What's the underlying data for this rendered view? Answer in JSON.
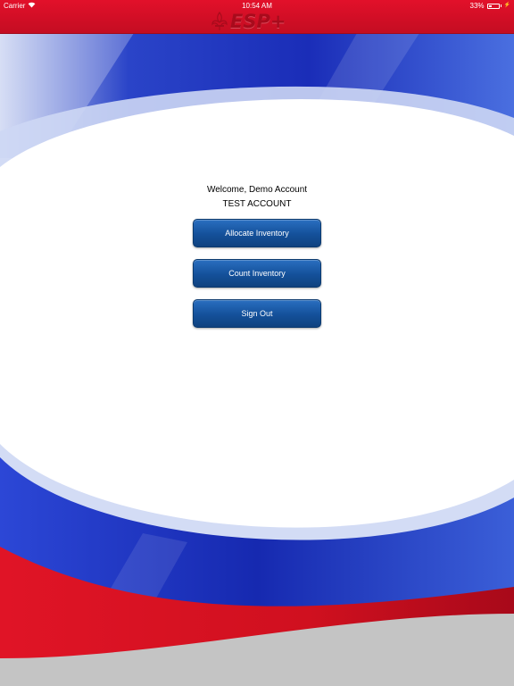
{
  "status_bar": {
    "carrier": "Carrier",
    "time": "10:54 AM",
    "battery": "33%",
    "battery_level": 0.33,
    "wifi_icon": "wifi-icon"
  },
  "header": {
    "brand": "ESP+",
    "logo_icon": "fleur-de-lis-icon"
  },
  "welcome": {
    "greeting": "Welcome, Demo Account",
    "account": "TEST ACCOUNT"
  },
  "buttons": {
    "allocate": "Allocate Inventory",
    "count": "Count Inventory",
    "sign_out": "Sign Out"
  },
  "colors": {
    "brand_red": "#e2102a",
    "brand_blue": "#1a2fb8",
    "button_blue": "#1d5fad"
  }
}
